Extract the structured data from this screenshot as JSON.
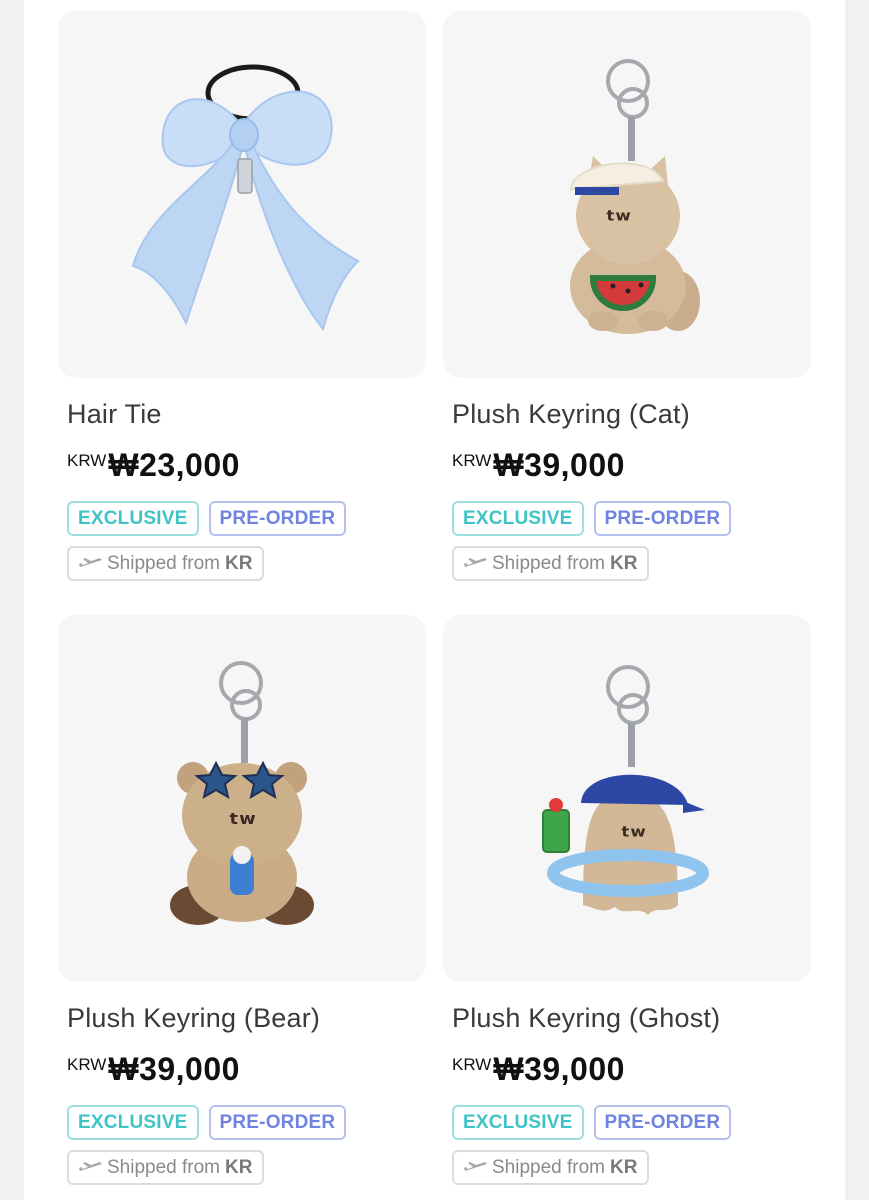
{
  "products": [
    {
      "name": "Hair Tie",
      "currency": "KRW",
      "price": "₩23,000",
      "badges": {
        "exclusive": "EXCLUSIVE",
        "preorder": "PRE-ORDER"
      },
      "shipping": {
        "text": "Shipped from",
        "country": "KR",
        "icon": "airplane-icon"
      }
    },
    {
      "name": "Plush Keyring (Cat)",
      "currency": "KRW",
      "price": "₩39,000",
      "badges": {
        "exclusive": "EXCLUSIVE",
        "preorder": "PRE-ORDER"
      },
      "shipping": {
        "text": "Shipped from",
        "country": "KR",
        "icon": "airplane-icon"
      }
    },
    {
      "name": "Plush Keyring (Bear)",
      "currency": "KRW",
      "price": "₩39,000",
      "badges": {
        "exclusive": "EXCLUSIVE",
        "preorder": "PRE-ORDER"
      },
      "shipping": {
        "text": "Shipped from",
        "country": "KR",
        "icon": "airplane-icon"
      }
    },
    {
      "name": "Plush Keyring (Ghost)",
      "currency": "KRW",
      "price": "₩39,000",
      "badges": {
        "exclusive": "EXCLUSIVE",
        "preorder": "PRE-ORDER"
      },
      "shipping": {
        "text": "Shipped from",
        "country": "KR",
        "icon": "airplane-icon"
      }
    }
  ],
  "colors": {
    "exclusive": "#40c3c4",
    "preorder": "#6f83e0",
    "thumb_bg": "#f6f6f6",
    "price": "#111111"
  }
}
